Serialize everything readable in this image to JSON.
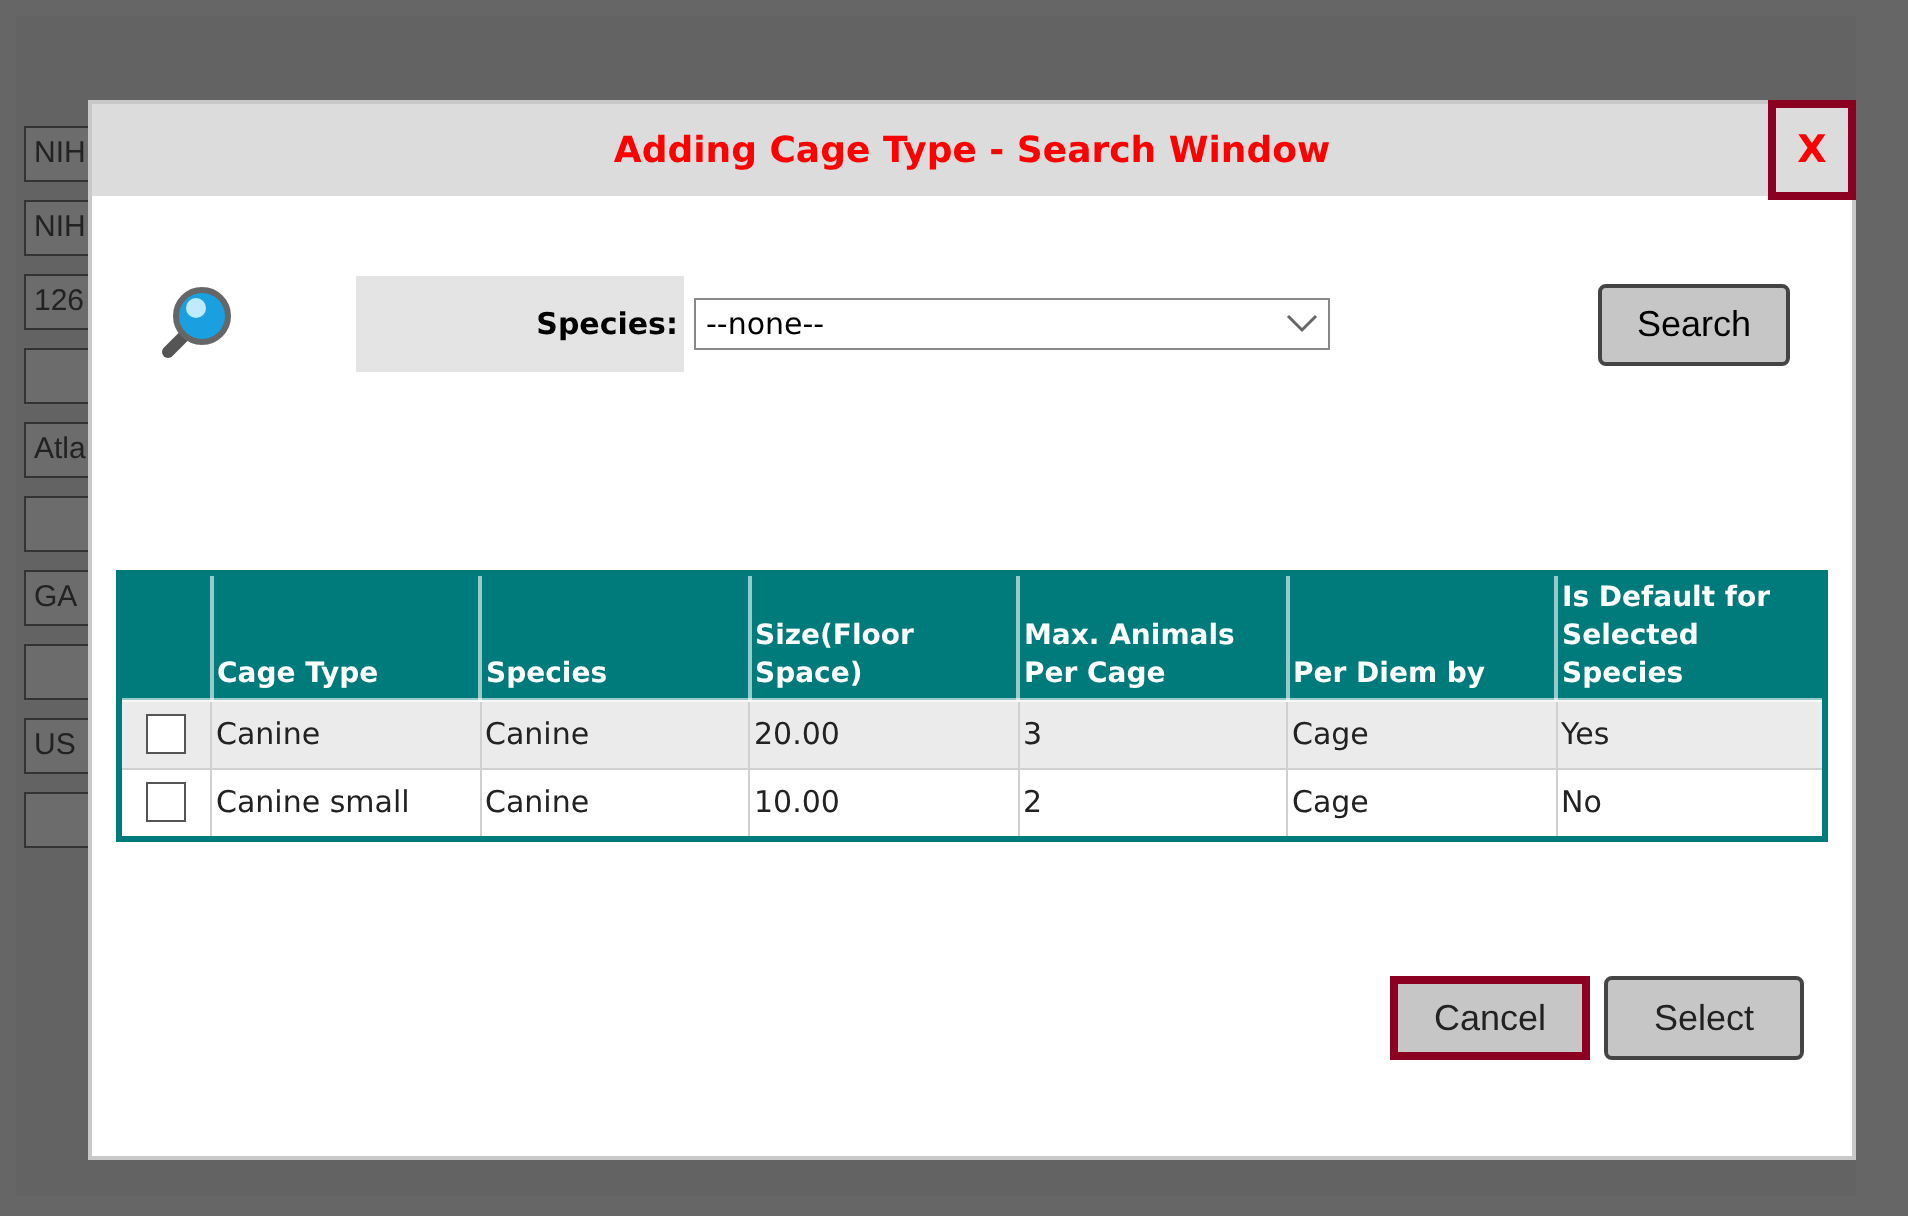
{
  "background_fields": [
    {
      "kind": "field",
      "text": "NIH"
    },
    {
      "kind": "field",
      "text": "NIH"
    },
    {
      "kind": "field",
      "text": "126"
    },
    {
      "kind": "field"
    },
    {
      "kind": "field",
      "text": "Atla"
    },
    {
      "kind": "field"
    },
    {
      "kind": "field",
      "text": "GA"
    },
    {
      "kind": "field"
    },
    {
      "kind": "field",
      "text": "US"
    },
    {
      "kind": "field"
    }
  ],
  "dialog": {
    "title": "Adding Cage Type - Search Window",
    "close_button": {
      "label": "X",
      "focused": true
    },
    "search": {
      "label": "Species:",
      "value": "--none--",
      "button": "Search"
    },
    "table": {
      "columns": [
        "Cage Type",
        "Species",
        "Size(Floor Space)",
        "Max. Animals Per Cage",
        "Per Diem by",
        "Is Default for Selected Species"
      ],
      "rows": [
        {
          "checked": false,
          "cells": [
            "Canine",
            "Canine",
            "20.00",
            "3",
            "Cage",
            "Yes"
          ]
        },
        {
          "checked": false,
          "cells": [
            "Canine small",
            "Canine",
            "10.00",
            "2",
            "Cage",
            "No"
          ]
        }
      ]
    },
    "buttons": [
      {
        "label": "Cancel",
        "focused": true
      },
      {
        "label": "Select",
        "focused": false
      }
    ]
  }
}
